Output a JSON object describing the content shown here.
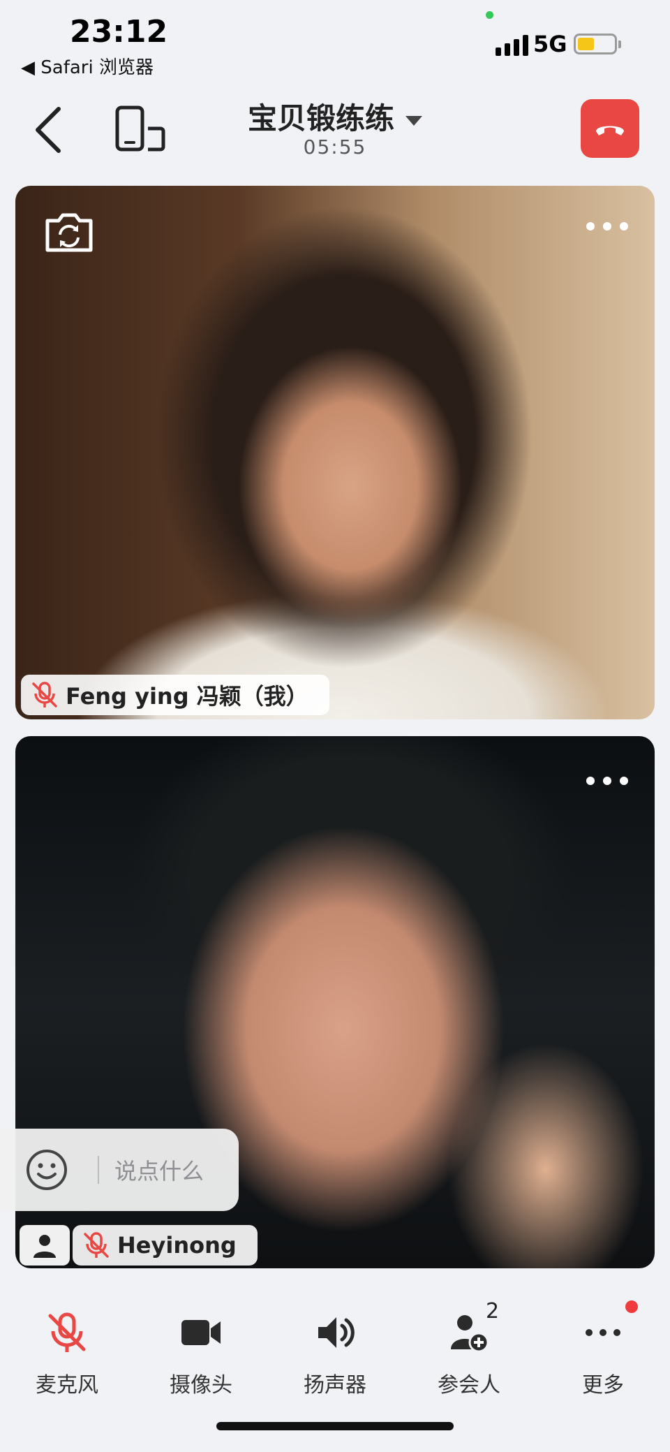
{
  "status": {
    "time": "23:12",
    "back_app": "◀ Safari 浏览器",
    "network": "5G",
    "battery_level": 0.45
  },
  "header": {
    "title": "宝贝锻练练",
    "timer": "05:55"
  },
  "participants": [
    {
      "name": "Feng ying 冯颖（我）",
      "mic_muted": true
    },
    {
      "name": "Heyinong",
      "mic_muted": true
    }
  ],
  "comment": {
    "placeholder": "说点什么"
  },
  "toolbar": {
    "mic": "麦克风",
    "camera": "摄像头",
    "speaker": "扬声器",
    "participants": "参会人",
    "participants_count": "2",
    "more": "更多"
  },
  "colors": {
    "hangup": "#e94743",
    "muted": "#e94743"
  }
}
